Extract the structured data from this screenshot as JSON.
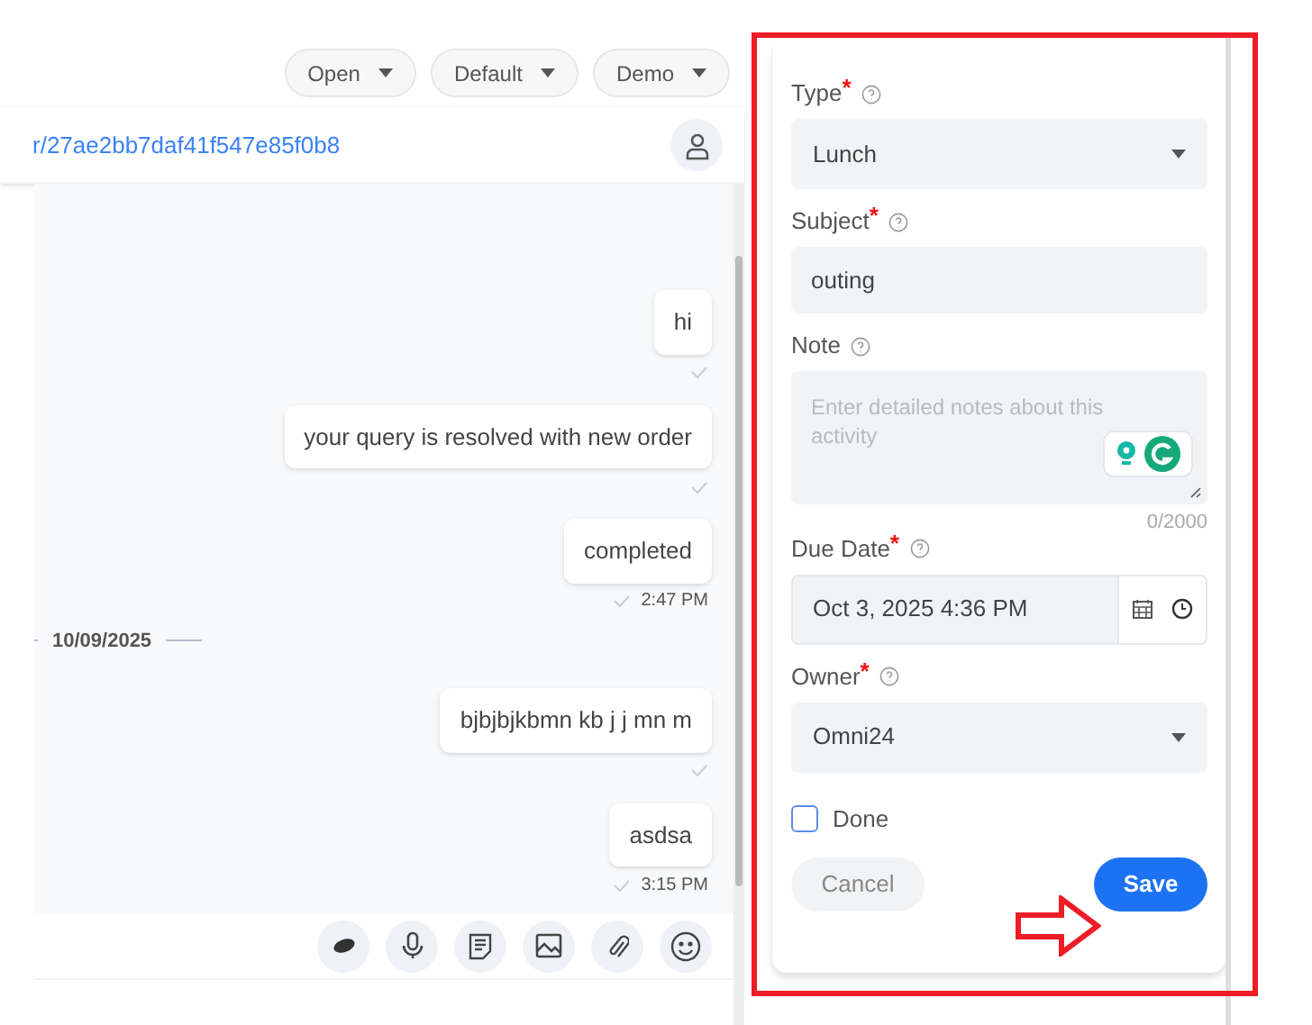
{
  "filters": [
    {
      "label": "Open"
    },
    {
      "label": "Default"
    },
    {
      "label": "Demo"
    }
  ],
  "conversation_link": "r/27ae2bb7daf41f547e85f0b8",
  "messages": [
    {
      "kind": "message",
      "text": "hi"
    },
    {
      "kind": "message",
      "text": "your query is resolved with new order"
    },
    {
      "kind": "message",
      "text": "completed",
      "time": "2:47 PM"
    },
    {
      "kind": "date",
      "text": "10/09/2025"
    },
    {
      "kind": "message",
      "text": "bjbjbjkbmn kb j j mn m"
    },
    {
      "kind": "message",
      "text": "asdsa",
      "time": "3:15 PM"
    }
  ],
  "form": {
    "fields": [
      {
        "kind": "select",
        "label": "Type",
        "required_mark": "*",
        "value": "Lunch"
      },
      {
        "kind": "text",
        "label": "Subject",
        "required_mark": "*",
        "value": "outing"
      },
      {
        "kind": "textarea",
        "label": "Note",
        "placeholder": "Enter detailed notes about this activity",
        "counter": "0/2000"
      },
      {
        "kind": "datetime",
        "label": "Due Date",
        "required_mark": "*",
        "value": "Oct 3, 2025 4:36 PM"
      },
      {
        "kind": "select",
        "label": "Owner",
        "required_mark": "*",
        "value": "Omni24"
      }
    ],
    "done": {
      "label": "Done",
      "checked": false
    },
    "cancel": "Cancel",
    "save": "Save"
  }
}
